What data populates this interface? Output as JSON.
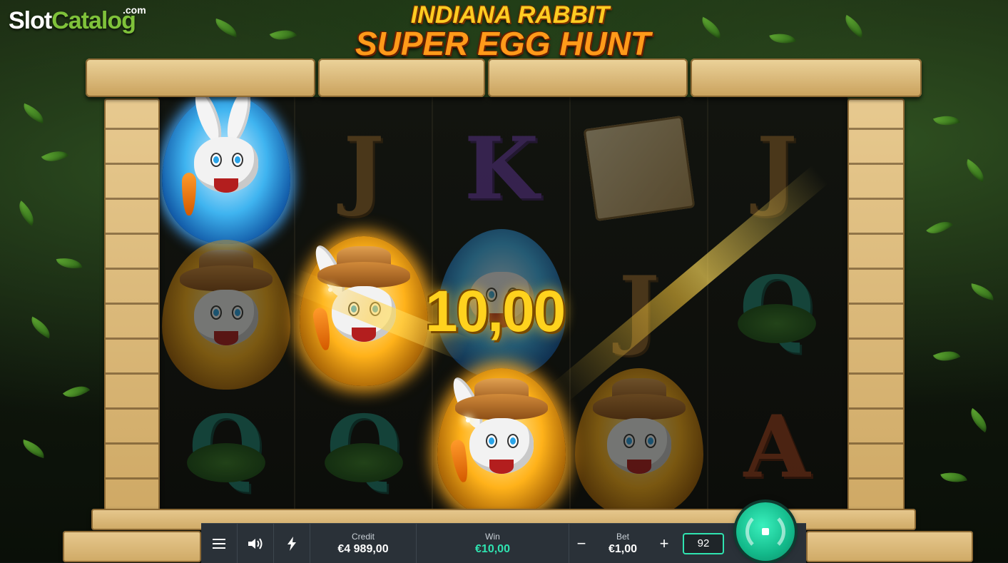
{
  "watermark": {
    "slot": "Slot",
    "catalog": "Catalog",
    "com": ".com"
  },
  "game": {
    "title_line1": "INDIANA RABBIT",
    "title_line2": "SUPER EGG HUNT"
  },
  "win_overlay": {
    "amount": "10,00"
  },
  "reels": [
    [
      "blue-egg-rabbit-carrot",
      "rabbit-explorer",
      "Q"
    ],
    [
      "J",
      "gold-egg-rabbit-explorer",
      "Q"
    ],
    [
      "K",
      "blue-egg-rabbit",
      "gold-egg-rabbit-explorer"
    ],
    [
      "treasure-map",
      "J",
      "rabbit-explorer"
    ],
    [
      "J",
      "Q",
      "A"
    ]
  ],
  "bottom_bar": {
    "menu_icon": "hamburger-icon",
    "sound_icon": "speaker-icon",
    "turbo_icon": "lightning-icon",
    "credit_label": "Credit",
    "credit_value": "€4 989,00",
    "win_label": "Win",
    "win_value": "€10,00",
    "bet_label": "Bet",
    "bet_value": "€1,00",
    "bet_minus": "−",
    "bet_plus": "+",
    "lines_value": "92",
    "spin_icon": "spin-icon"
  },
  "colors": {
    "accent": "#2fe3b0",
    "win_gold": "#ffd21e",
    "bar_bg": "#2a3138"
  }
}
